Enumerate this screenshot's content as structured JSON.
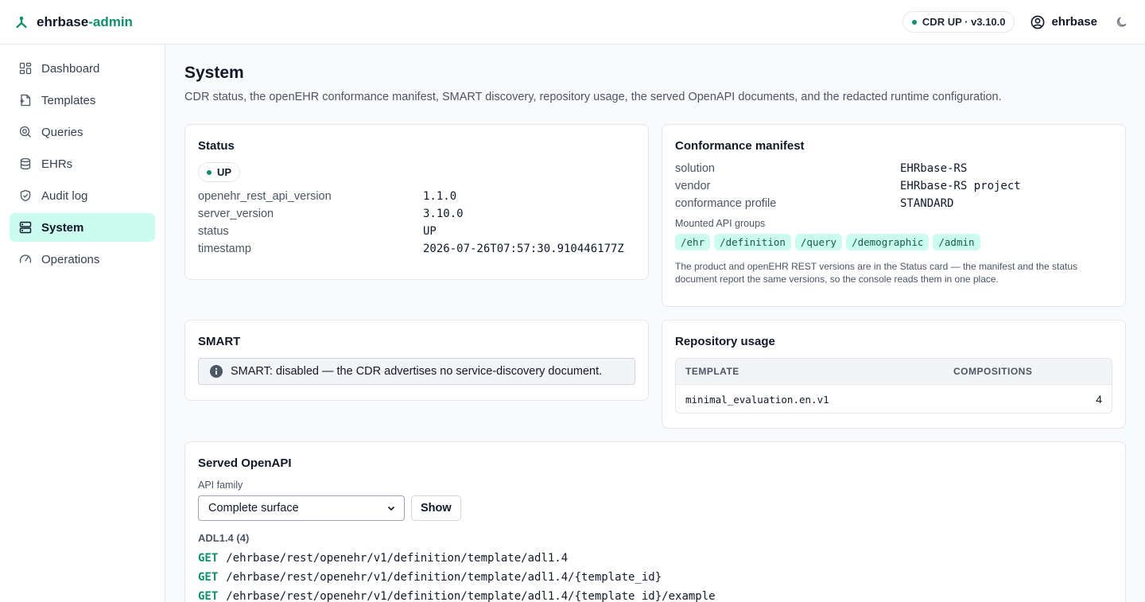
{
  "app": {
    "brand_main": "ehrbase",
    "brand_accent": "-admin",
    "cdr_status": "CDR UP · v3.10.0",
    "username": "ehrbase",
    "accent_color": "#0f8f6e"
  },
  "sidebar": {
    "items": [
      {
        "label": "Dashboard",
        "icon": "dashboard-icon"
      },
      {
        "label": "Templates",
        "icon": "template-icon"
      },
      {
        "label": "Queries",
        "icon": "query-icon"
      },
      {
        "label": "EHRs",
        "icon": "database-icon"
      },
      {
        "label": "Audit log",
        "icon": "shield-icon"
      },
      {
        "label": "System",
        "icon": "server-icon",
        "active": true
      },
      {
        "label": "Operations",
        "icon": "gauge-icon"
      }
    ]
  },
  "page": {
    "title": "System",
    "subtitle": "CDR status, the openEHR conformance manifest, SMART discovery, repository usage, the served OpenAPI documents, and the redacted runtime configuration."
  },
  "status_card": {
    "title": "Status",
    "badge": "UP",
    "rows": [
      {
        "key": "openehr_rest_api_version",
        "value": "1.1.0"
      },
      {
        "key": "server_version",
        "value": "3.10.0"
      },
      {
        "key": "status",
        "value": "UP"
      },
      {
        "key": "timestamp",
        "value": "2026-07-26T07:57:30.910446177Z"
      }
    ]
  },
  "conformance_card": {
    "title": "Conformance manifest",
    "rows": [
      {
        "key": "solution",
        "value": "EHRbase-RS"
      },
      {
        "key": "vendor",
        "value": "EHRbase-RS project"
      },
      {
        "key": "conformance profile",
        "value": "STANDARD"
      }
    ],
    "groups_label": "Mounted API groups",
    "groups": [
      "/ehr",
      "/definition",
      "/query",
      "/demographic",
      "/admin"
    ],
    "note": "The product and openEHR REST versions are in the Status card — the manifest and the status document report the same versions, so the console reads them in one place."
  },
  "smart_card": {
    "title": "SMART",
    "message": "SMART: disabled — the CDR advertises no service-discovery document."
  },
  "repo_card": {
    "title": "Repository usage",
    "columns": [
      "TEMPLATE",
      "COMPOSITIONS"
    ],
    "rows": [
      {
        "template": "minimal_evaluation.en.v1",
        "compositions": "4"
      }
    ]
  },
  "openapi_card": {
    "title": "Served OpenAPI",
    "family_label": "API family",
    "family_selected": "Complete surface",
    "show_label": "Show",
    "group_title": "ADL1.4 (4)",
    "endpoints": [
      {
        "method": "GET",
        "path": "/ehrbase/rest/openehr/v1/definition/template/adl1.4"
      },
      {
        "method": "GET",
        "path": "/ehrbase/rest/openehr/v1/definition/template/adl1.4/{template_id}"
      },
      {
        "method": "GET",
        "path": "/ehrbase/rest/openehr/v1/definition/template/adl1.4/{template_id}/example"
      }
    ]
  }
}
